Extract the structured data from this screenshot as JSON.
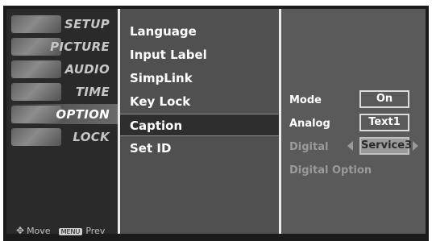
{
  "categories": [
    {
      "label": "SETUP",
      "icon": "satellite-dish-icon"
    },
    {
      "label": "PICTURE",
      "icon": "color-palette-icon"
    },
    {
      "label": "AUDIO",
      "icon": "speaker-icon"
    },
    {
      "label": "TIME",
      "icon": "clock-icon"
    },
    {
      "label": "OPTION",
      "icon": "option-tag-icon",
      "active": true
    },
    {
      "label": "LOCK",
      "icon": "lock-icon"
    }
  ],
  "help": {
    "move": "Move",
    "menu_key": "MENU",
    "prev": "Prev"
  },
  "menu_items": [
    {
      "label": "Language"
    },
    {
      "label": "Input Label"
    },
    {
      "label": "SimpLink"
    },
    {
      "label": "Key Lock"
    },
    {
      "label": "Caption",
      "selected": true
    },
    {
      "label": "Set ID"
    }
  ],
  "caption_settings": {
    "mode": {
      "label": "Mode",
      "value": "On"
    },
    "analog": {
      "label": "Analog",
      "value": "Text1"
    },
    "digital": {
      "label": "Digital",
      "value": "Service3"
    },
    "digital_option": {
      "label": "Digital Option"
    }
  }
}
